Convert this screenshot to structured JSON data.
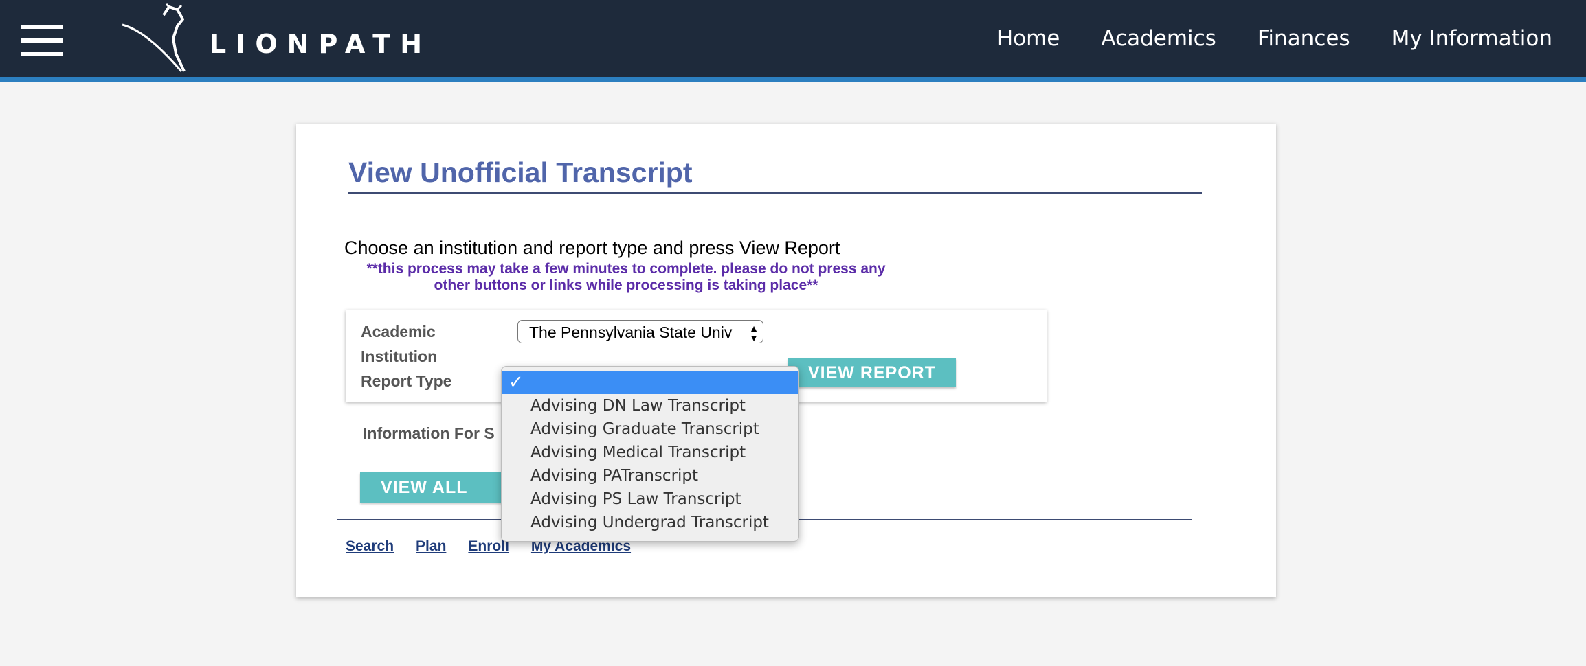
{
  "header": {
    "logo_text": "LIONPATH",
    "nav": [
      "Home",
      "Academics",
      "Finances",
      "My Information"
    ]
  },
  "page": {
    "title": "View Unofficial Transcript",
    "instructions": "Choose an institution and report type and press View Report",
    "warning": "**this process may take a few minutes to complete. please do not press any other buttons or links while processing is taking place**"
  },
  "form": {
    "institution_label_line1": "Academic",
    "institution_label_line2": "Institution",
    "institution_value": "The Pennsylvania State Univ",
    "report_type_label": "Report Type",
    "view_report_button": "VIEW REPORT",
    "info_label": "Information For S",
    "view_all_button": "VIEW ALL REQ"
  },
  "dropdown": {
    "selected_check": "✓",
    "options": [
      "",
      "Advising DN Law Transcript",
      "Advising Graduate Transcript",
      "Advising Medical Transcript",
      "Advising PATranscript",
      "Advising PS Law Transcript",
      "Advising Undergrad Transcript"
    ]
  },
  "footer": {
    "links": [
      "Search",
      "Plan",
      "Enroll",
      "My Academics"
    ]
  },
  "colors": {
    "topbar": "#1e2a3b",
    "accent": "#2c7fc0",
    "title": "#5065aa",
    "button": "#5cbfc1",
    "dropdown_selected": "#3b8ef5",
    "warning": "#5b2ca8"
  }
}
